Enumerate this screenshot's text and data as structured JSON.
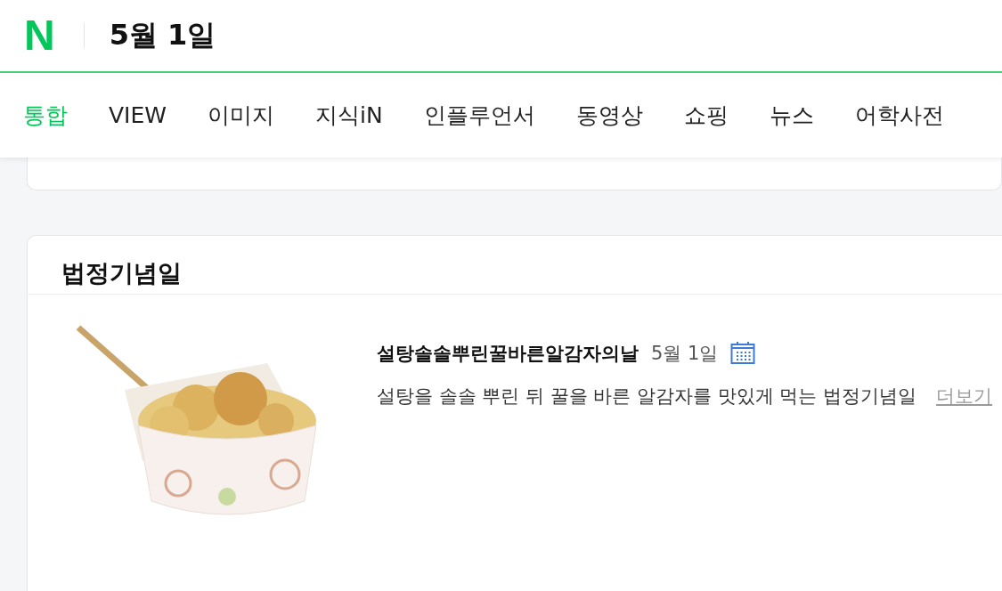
{
  "header": {
    "logo": "N",
    "title": "5월 1일"
  },
  "tabs": [
    {
      "label": "통합",
      "selected": true
    },
    {
      "label": "VIEW",
      "selected": false
    },
    {
      "label": "이미지",
      "selected": false
    },
    {
      "label": "지식iN",
      "selected": false
    },
    {
      "label": "인플루언서",
      "selected": false
    },
    {
      "label": "동영상",
      "selected": false
    },
    {
      "label": "쇼핑",
      "selected": false
    },
    {
      "label": "뉴스",
      "selected": false
    },
    {
      "label": "어학사전",
      "selected": false
    }
  ],
  "card": {
    "heading": "법정기념일",
    "event": {
      "name": "설탕솔솔뿌린꿀바른알감자의날",
      "date": "5월 1일",
      "description": "설탕을 솔솔 뿌린 뒤 꿀을 바른 알감자를 맛있게 먹는 법정기념일",
      "more": "더보기"
    }
  }
}
